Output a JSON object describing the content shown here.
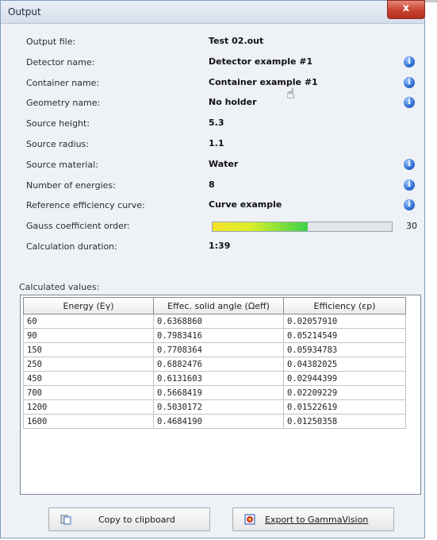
{
  "window": {
    "title": "Output",
    "close_glyph": "x"
  },
  "info": [
    {
      "label": "Output file:",
      "value": "Test 02.out",
      "info_icon": false
    },
    {
      "label": "Detector name:",
      "value": "Detector example #1",
      "info_icon": true
    },
    {
      "label": "Container name:",
      "value": "Container example #1",
      "info_icon": true
    },
    {
      "label": "Geometry name:",
      "value": "No holder",
      "info_icon": true
    },
    {
      "label": "Source height:",
      "value": "5.3",
      "info_icon": false
    },
    {
      "label": "Source radius:",
      "value": "1.1",
      "info_icon": false
    },
    {
      "label": "Source material:",
      "value": "Water",
      "info_icon": true
    },
    {
      "label": "Number of energies:",
      "value": "8",
      "info_icon": true
    },
    {
      "label": "Reference efficiency curve:",
      "value": "Curve example",
      "info_icon": true
    },
    {
      "label": "Gauss coefficient order:",
      "value": "30",
      "info_icon": false
    },
    {
      "label": "Calculation duration:",
      "value": "1:39",
      "info_icon": false
    }
  ],
  "gauss_fill_fraction": 0.53,
  "info_icon_glyph": "i",
  "calculated": {
    "label": "Calculated values:",
    "columns": [
      "Energy (Eγ)",
      "Effec. solid angle (Ωeff)",
      "Efficiency (εp)"
    ],
    "rows": [
      [
        "60",
        "0.6368860",
        "0.02057910"
      ],
      [
        "90",
        "0.7983416",
        "0.05214549"
      ],
      [
        "150",
        "0.7708364",
        "0.05934783"
      ],
      [
        "250",
        "0.6882476",
        "0.04382025"
      ],
      [
        "450",
        "0.6131603",
        "0.02944399"
      ],
      [
        "700",
        "0.5668419",
        "0.02209229"
      ],
      [
        "1200",
        "0.5030172",
        "0.01522619"
      ],
      [
        "1600",
        "0.4684190",
        "0.01250358"
      ]
    ]
  },
  "buttons": {
    "copy": "Copy to clipboard",
    "export": "Export to GammaVision"
  },
  "colors": {
    "info_icon": "#2f6fd3",
    "close": "#c7412f"
  }
}
